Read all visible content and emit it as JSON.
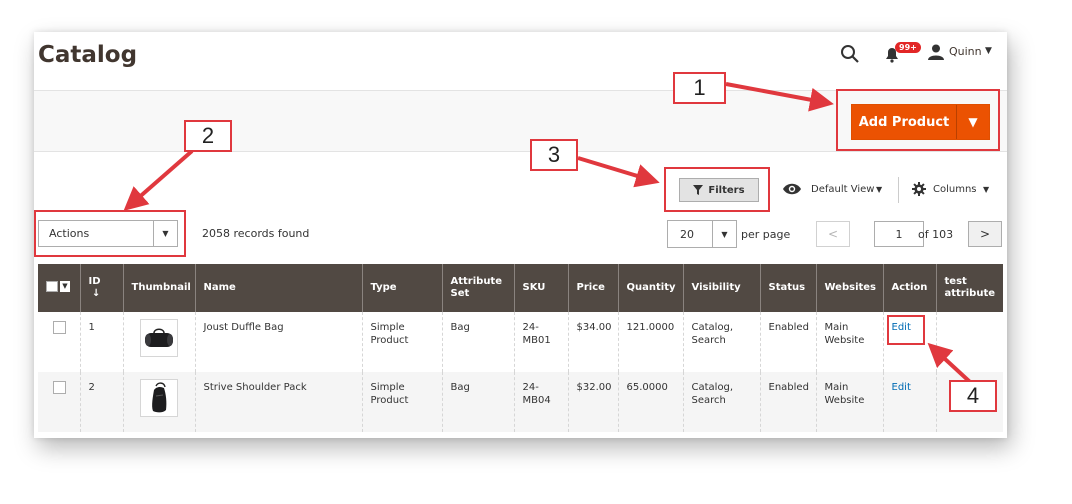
{
  "header": {
    "title": "Catalog",
    "notification_count": "99+",
    "user_name": "Quinn"
  },
  "actions_band": {
    "add_product_label": "Add Product"
  },
  "toolbar": {
    "filters_label": "Filters",
    "view_label": "Default View",
    "columns_label": "Columns",
    "actions_label": "Actions",
    "records_found": "2058 records found",
    "per_page_value": "20",
    "per_page_label": "per page",
    "current_page": "1",
    "page_total_label": "of 103"
  },
  "table": {
    "columns": [
      "ID",
      "Thumbnail",
      "Name",
      "Type",
      "Attribute Set",
      "SKU",
      "Price",
      "Quantity",
      "Visibility",
      "Status",
      "Websites",
      "Action",
      "test attribute"
    ],
    "rows": [
      {
        "id": "1",
        "name": "Joust Duffle Bag",
        "type": "Simple Product",
        "attribute_set": "Bag",
        "sku": "24-MB01",
        "price": "$34.00",
        "quantity": "121.0000",
        "visibility": "Catalog, Search",
        "status": "Enabled",
        "websites": "Main Website",
        "action": "Edit",
        "test_attribute": ""
      },
      {
        "id": "2",
        "name": "Strive Shoulder Pack",
        "type": "Simple Product",
        "attribute_set": "Bag",
        "sku": "24-MB04",
        "price": "$32.00",
        "quantity": "65.0000",
        "visibility": "Catalog, Search",
        "status": "Enabled",
        "websites": "Main Website",
        "action": "Edit",
        "test_attribute": ""
      }
    ]
  },
  "callouts": [
    "1",
    "2",
    "3",
    "4"
  ],
  "colors": {
    "accent": "#eb5202",
    "table_header": "#514943",
    "annotation": "#e0383e",
    "link": "#006bb4"
  }
}
